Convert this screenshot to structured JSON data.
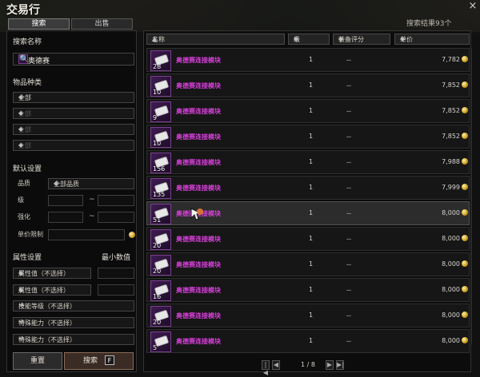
{
  "window": {
    "title": "交易行",
    "result_count": "搜索结果93个",
    "close_icon": "close-icon"
  },
  "tabs": [
    {
      "label": "搜索",
      "active": true
    },
    {
      "label": "出售",
      "active": false
    }
  ],
  "left": {
    "search_section_title": "搜索名称",
    "search_value": "奥德赛",
    "category_title": "物品种类",
    "category_selects": [
      "全部",
      "全部",
      "全部",
      "全部"
    ],
    "default_title": "默认设置",
    "quality_label": "品质",
    "quality_value": "全部品质",
    "level_label": "级",
    "enhance_label": "强化",
    "unit_price_limit_label": "单价限制",
    "attr_title": "属性设置",
    "min_value_label": "最小数值",
    "attr_rows": [
      {
        "label": "属性值（不选择）"
      },
      {
        "label": "属性值（不选择）"
      }
    ],
    "plus_rows": [
      {
        "label": "技能等级（不选择）"
      },
      {
        "label": "特殊能力（不选择）"
      },
      {
        "label": "特殊能力（不选择）"
      }
    ],
    "reset_button": "重置",
    "search_button": "搜索",
    "search_hotkey": "F"
  },
  "table": {
    "headers": [
      "名称",
      "级",
      "装备评分",
      "单价"
    ],
    "items": [
      {
        "qty": "28",
        "name": "奥德赛连接模块",
        "level": "1",
        "score": "－",
        "price": "7,782"
      },
      {
        "qty": "10",
        "name": "奥德赛连接模块",
        "level": "1",
        "score": "－",
        "price": "7,852"
      },
      {
        "qty": "9",
        "name": "奥德赛连接模块",
        "level": "1",
        "score": "－",
        "price": "7,852"
      },
      {
        "qty": "10",
        "name": "奥德赛连接模块",
        "level": "1",
        "score": "－",
        "price": "7,852"
      },
      {
        "qty": "156",
        "name": "奥德赛连接模块",
        "level": "1",
        "score": "－",
        "price": "7,988"
      },
      {
        "qty": "135",
        "name": "奥德赛连接模块",
        "level": "1",
        "score": "－",
        "price": "7,999"
      },
      {
        "qty": "51",
        "name": "奥德赛连接模块",
        "level": "1",
        "score": "－",
        "price": "8,000",
        "highlight": true
      },
      {
        "qty": "20",
        "name": "奥德赛连接模块",
        "level": "1",
        "score": "－",
        "price": "8,000"
      },
      {
        "qty": "20",
        "name": "奥德赛连接模块",
        "level": "1",
        "score": "－",
        "price": "8,000"
      },
      {
        "qty": "16",
        "name": "奥德赛连接模块",
        "level": "1",
        "score": "－",
        "price": "8,000"
      },
      {
        "qty": "20",
        "name": "奥德赛连接模块",
        "level": "1",
        "score": "－",
        "price": "8,000"
      },
      {
        "qty": "5",
        "name": "奥德赛连接模块",
        "level": "1",
        "score": "－",
        "price": "8,000"
      }
    ]
  },
  "pager": {
    "text": "1 / 8"
  }
}
